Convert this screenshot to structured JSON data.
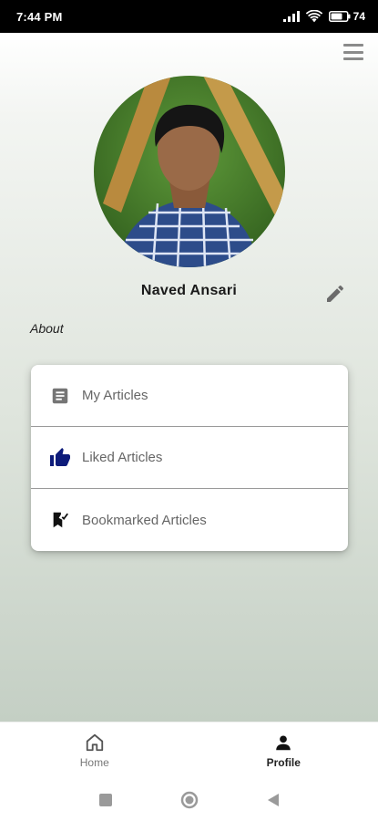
{
  "status_bar": {
    "time": "7:44 PM",
    "battery": "74"
  },
  "profile": {
    "name": "Naved Ansari",
    "about_label": "About"
  },
  "menu": {
    "items": [
      {
        "label": "My Articles",
        "icon": "article-icon",
        "icon_color": "#757575"
      },
      {
        "label": "Liked Articles",
        "icon": "thumb-up-icon",
        "icon_color": "#0d1b7a"
      },
      {
        "label": "Bookmarked Articles",
        "icon": "bookmark-check-icon",
        "icon_color": "#111111"
      }
    ]
  },
  "bottom_nav": {
    "items": [
      {
        "label": "Home",
        "icon": "home-icon",
        "active": false
      },
      {
        "label": "Profile",
        "icon": "person-icon",
        "active": true
      }
    ]
  },
  "colors": {
    "accent": "#0d1b7a",
    "status_bar_bg": "#000000",
    "background_top": "#ffffff",
    "background_bottom": "#c4cfc4"
  }
}
